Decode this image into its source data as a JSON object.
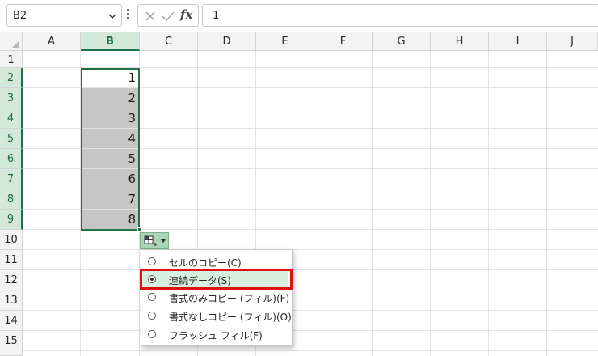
{
  "formula_bar": {
    "name_box": "B2",
    "fx_label": "fx",
    "formula_value": "1"
  },
  "columns": [
    "A",
    "B",
    "C",
    "D",
    "E",
    "F",
    "G",
    "H",
    "I",
    "J"
  ],
  "rows": [
    "1",
    "2",
    "3",
    "4",
    "5",
    "6",
    "7",
    "8",
    "9",
    "10",
    "11",
    "12",
    "13",
    "14",
    "15"
  ],
  "cells_b": [
    "1",
    "2",
    "3",
    "4",
    "5",
    "6",
    "7",
    "8"
  ],
  "autofill_menu": {
    "items": [
      {
        "label": "セルのコピー(C)",
        "selected": false
      },
      {
        "label": "連続データ(S)",
        "selected": true
      },
      {
        "label": "書式のみコピー (フィル)(F)",
        "selected": false
      },
      {
        "label": "書式なしコピー (フィル)(O)",
        "selected": false
      },
      {
        "label": "フラッシュ フィル(F)",
        "selected": false
      }
    ]
  },
  "colors": {
    "selection_accent": "#217346",
    "selected_header_bg": "#d2e8da",
    "fill_shade": "#c6c6c6",
    "highlight_box": "#e01010"
  }
}
